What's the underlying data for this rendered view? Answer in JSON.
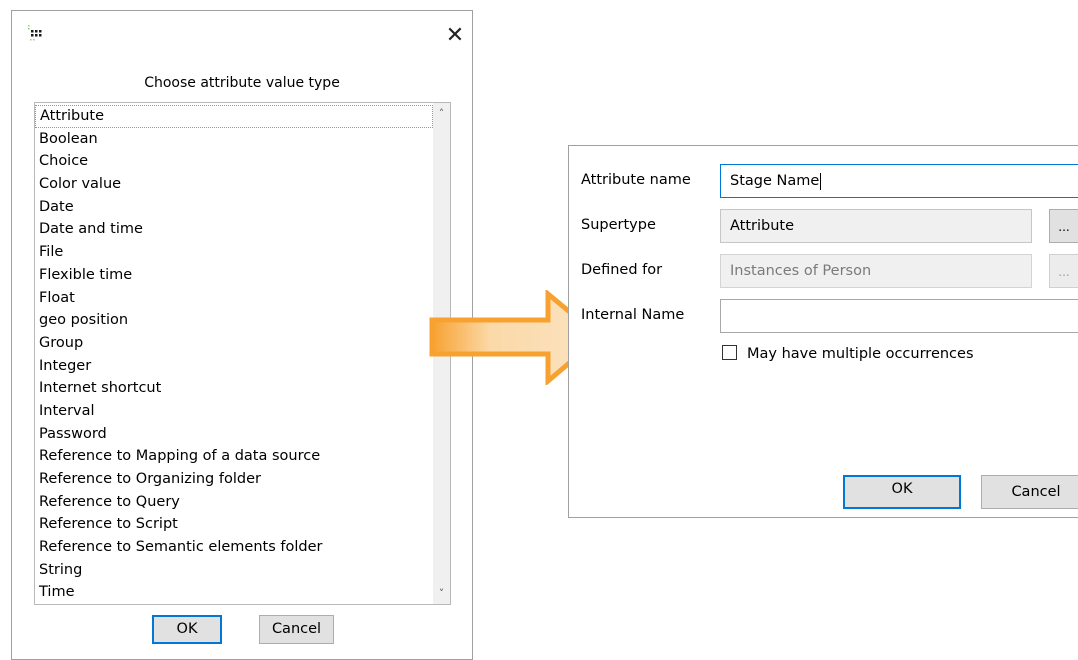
{
  "left_dialog": {
    "icon": "app-grid-icon",
    "close_glyph": "✕",
    "prompt": "Choose attribute value type",
    "items": [
      "Attribute",
      "Boolean",
      "Choice",
      "Color value",
      "Date",
      "Date and time",
      "File",
      "Flexible time",
      "Float",
      "geo position",
      "Group",
      "Integer",
      "Internet shortcut",
      "Interval",
      "Password",
      "Reference to Mapping of a data source",
      "Reference to Organizing folder",
      "Reference to Query",
      "Reference to Script",
      "Reference to Semantic elements folder",
      "String",
      "Time"
    ],
    "selected_index": 0,
    "ok_label": "OK",
    "cancel_label": "Cancel"
  },
  "arrow": {
    "color": "#f7a230",
    "fill": "#fbe3c2"
  },
  "right_dialog": {
    "attribute_name_label": "Attribute name",
    "attribute_name_value": "Stage Name",
    "supertype_label": "Supertype",
    "supertype_value": "Attribute",
    "supertype_button": "...",
    "defined_for_label": "Defined for",
    "defined_for_value": "Instances of Person",
    "defined_for_button": "...",
    "internal_name_label": "Internal Name",
    "internal_name_value": "",
    "multiple_label": "May have multiple occurrences",
    "multiple_checked": false,
    "ok_label": "OK",
    "cancel_label": "Cancel"
  }
}
